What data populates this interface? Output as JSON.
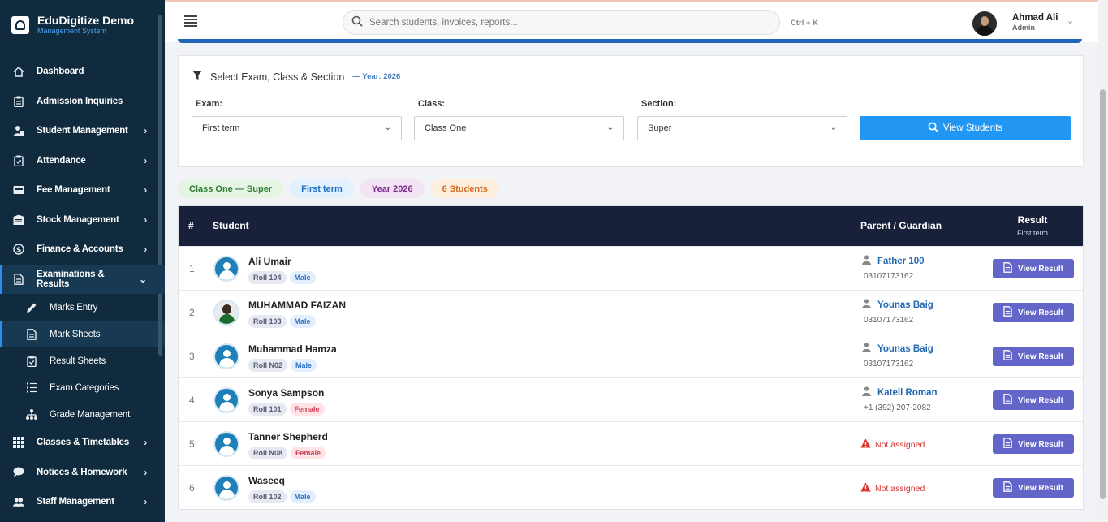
{
  "brand": {
    "title": "EduDigitize Demo",
    "subtitle": "Management System"
  },
  "sidebar": {
    "items": [
      {
        "label": "Dashboard",
        "icon": "home-icon",
        "chevron": ""
      },
      {
        "label": "Admission Inquiries",
        "icon": "clipboard-icon",
        "chevron": ""
      },
      {
        "label": "Student Management",
        "icon": "user-tie-icon",
        "chevron": "›"
      },
      {
        "label": "Attendance",
        "icon": "clipboard-check-icon",
        "chevron": "›"
      },
      {
        "label": "Fee Management",
        "icon": "money-icon",
        "chevron": "›"
      },
      {
        "label": "Stock Management",
        "icon": "warehouse-icon",
        "chevron": "›"
      },
      {
        "label": "Finance & Accounts",
        "icon": "dollar-circle-icon",
        "chevron": "›"
      },
      {
        "label": "Examinations & Results",
        "icon": "file-icon",
        "chevron": "⌄"
      }
    ],
    "subitems": [
      {
        "label": "Marks Entry",
        "icon": "pen-icon"
      },
      {
        "label": "Mark Sheets",
        "icon": "document-icon"
      },
      {
        "label": "Result Sheets",
        "icon": "clipboard-check-icon"
      },
      {
        "label": "Exam Categories",
        "icon": "list-icon"
      },
      {
        "label": "Grade Management",
        "icon": "sitemap-icon"
      }
    ],
    "items_after": [
      {
        "label": "Classes & Timetables",
        "icon": "grid-icon",
        "chevron": "›"
      },
      {
        "label": "Notices & Homework",
        "icon": "comment-icon",
        "chevron": "›"
      },
      {
        "label": "Staff Management",
        "icon": "users-icon",
        "chevron": "›"
      }
    ]
  },
  "topbar": {
    "search_placeholder": "Search students, invoices, reports...",
    "shortcut": "Ctrl + K",
    "user_name": "Ahmad Ali",
    "user_role": "Admin"
  },
  "filter": {
    "title": "Select Exam, Class & Section",
    "year_label": "— Year: 2026",
    "exam_label": "Exam:",
    "exam_value": "First term",
    "class_label": "Class:",
    "class_value": "Class One",
    "section_label": "Section:",
    "section_value": "Super",
    "button_label": "View Students"
  },
  "chips": [
    {
      "label": "Class One — Super",
      "bg": "#e6f4e4",
      "color": "#2e7d32"
    },
    {
      "label": "First term",
      "bg": "#e3f0fd",
      "color": "#1e6fc4"
    },
    {
      "label": "Year 2026",
      "bg": "#f3e4f5",
      "color": "#7b2a8c"
    },
    {
      "label": "6 Students",
      "bg": "#fdeedd",
      "color": "#d2691e"
    }
  ],
  "table": {
    "headers": {
      "num": "#",
      "student": "Student",
      "guardian": "Parent / Guardian",
      "result": "Result",
      "result_sub": "First term"
    },
    "view_result_label": "View Result",
    "not_assigned_label": "Not assigned",
    "rows": [
      {
        "num": "1",
        "name": "Ali Umair",
        "roll": "Roll 104",
        "gender": "Male",
        "guardian": "Father 100",
        "phone": "03107173162",
        "photo": false
      },
      {
        "num": "2",
        "name": "MUHAMMAD FAIZAN",
        "roll": "Roll 103",
        "gender": "Male",
        "guardian": "Younas Baig",
        "phone": "03107173162",
        "photo": true
      },
      {
        "num": "3",
        "name": "Muhammad Hamza",
        "roll": "Roll N02",
        "gender": "Male",
        "guardian": "Younas Baig",
        "phone": "03107173162",
        "photo": false
      },
      {
        "num": "4",
        "name": "Sonya Sampson",
        "roll": "Roll 101",
        "gender": "Female",
        "guardian": "Katell Roman",
        "phone": "+1 (392) 207-2082",
        "photo": false
      },
      {
        "num": "5",
        "name": "Tanner Shepherd",
        "roll": "Roll N08",
        "gender": "Female",
        "guardian": "",
        "phone": "",
        "photo": false
      },
      {
        "num": "6",
        "name": "Waseeq",
        "roll": "Roll 102",
        "gender": "Male",
        "guardian": "",
        "phone": "",
        "photo": false
      }
    ]
  }
}
